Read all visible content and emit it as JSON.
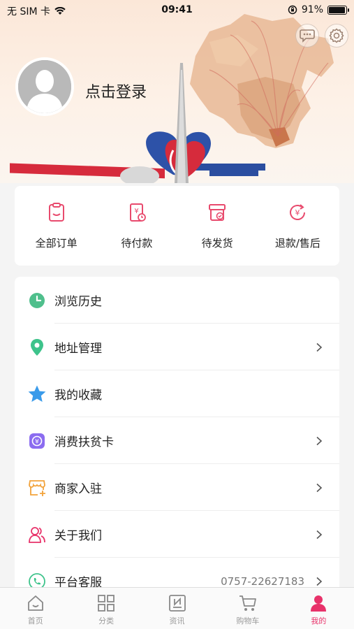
{
  "status_bar": {
    "carrier": "无 SIM 卡",
    "time": "09:41",
    "battery": "91%"
  },
  "header": {
    "login_text": "点击登录"
  },
  "orders": [
    {
      "label": "全部订单",
      "icon": "order-list-icon"
    },
    {
      "label": "待付款",
      "icon": "pending-payment-icon"
    },
    {
      "label": "待发货",
      "icon": "pending-shipment-icon"
    },
    {
      "label": "退款/售后",
      "icon": "refund-icon"
    }
  ],
  "menu": [
    {
      "label": "浏览历史",
      "icon": "clock-icon",
      "value": "",
      "chevron": false
    },
    {
      "label": "地址管理",
      "icon": "location-pin-icon",
      "value": "",
      "chevron": true
    },
    {
      "label": "我的收藏",
      "icon": "star-icon",
      "value": "",
      "chevron": false
    },
    {
      "label": "消费扶贫卡",
      "icon": "yuan-card-icon",
      "value": "",
      "chevron": true
    },
    {
      "label": "商家入驻",
      "icon": "store-icon",
      "value": "",
      "chevron": true
    },
    {
      "label": "关于我们",
      "icon": "users-icon",
      "value": "",
      "chevron": true
    },
    {
      "label": "平台客服",
      "icon": "phone-icon",
      "value": "0757-22627183",
      "chevron": true
    }
  ],
  "tabs": [
    {
      "label": "首页",
      "icon": "home-icon",
      "active": false
    },
    {
      "label": "分类",
      "icon": "grid-icon",
      "active": false
    },
    {
      "label": "资讯",
      "icon": "news-icon",
      "active": false
    },
    {
      "label": "购物车",
      "icon": "cart-icon",
      "active": false
    },
    {
      "label": "我的",
      "icon": "profile-icon",
      "active": true
    }
  ],
  "colors": {
    "accent": "#e8326a",
    "order_icon": "#e84a6d",
    "clock": "#4fbf8c",
    "location": "#3ec38b",
    "star": "#3a9bea",
    "card": "#8b6cf0",
    "store": "#f2a23a",
    "users": "#e8326a",
    "phone": "#3ec38b"
  }
}
